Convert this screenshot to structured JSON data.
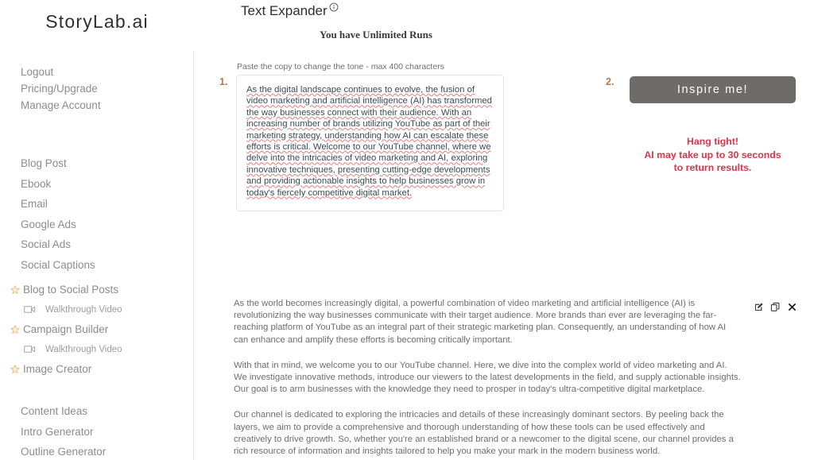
{
  "brand": {
    "name": "StoryLab.ai"
  },
  "sidebar": {
    "account_nav": [
      {
        "label": "Logout",
        "name": "logout"
      },
      {
        "label": "Pricing/Upgrade",
        "name": "pricing-upgrade"
      },
      {
        "label": "Manage Account",
        "name": "manage-account"
      }
    ],
    "tool_nav": [
      {
        "label": "Blog Post",
        "name": "blog-post"
      },
      {
        "label": "Ebook",
        "name": "ebook"
      },
      {
        "label": "Email",
        "name": "email"
      },
      {
        "label": "Google Ads",
        "name": "google-ads"
      },
      {
        "label": "Social Ads",
        "name": "social-ads"
      },
      {
        "label": "Social Captions",
        "name": "social-captions"
      }
    ],
    "featured": [
      {
        "label": "Blog to Social Posts",
        "icon": "star-icon",
        "name": "blog-to-social-posts"
      },
      {
        "label": "Walkthrough Video",
        "icon": "video-icon",
        "name": "walkthrough-video-blog-to-social"
      },
      {
        "label": "Campaign Builder",
        "icon": "star-icon",
        "name": "campaign-builder"
      },
      {
        "label": "Walkthrough Video",
        "icon": "video-icon",
        "name": "walkthrough-video-campaign-builder"
      },
      {
        "label": "Image Creator",
        "icon": "star-icon",
        "name": "image-creator"
      }
    ],
    "bottom_nav": [
      {
        "label": "Content Ideas",
        "name": "content-ideas"
      },
      {
        "label": "Intro Generator",
        "name": "intro-generator"
      },
      {
        "label": "Outline Generator",
        "name": "outline-generator"
      }
    ]
  },
  "header": {
    "title": "Text Expander",
    "info_icon": "info-circle-icon",
    "runs_status": "You have Unlimited Runs"
  },
  "input_section": {
    "step_marker": "1.",
    "hint": "Paste the copy to change the tone - max 400 characters",
    "value": "As the digital landscape continues to evolve, the fusion of video marketing and artificial intelligence (AI) has transformed the way businesses connect with their audience. With an increasing number of brands utilizing YouTube as part of their marketing strategy, understanding how AI can escalate these efforts is critical. Welcome to our YouTube channel, where we delve into the intricacies of video marketing and AI, exploring innovative techniques, presenting cutting-edge developments and providing actionable insights to help businesses grow in today's fiercely competitive digital market."
  },
  "action_section": {
    "step_marker": "2.",
    "button_label": "Inspire me!",
    "notice_line_1": "Hang tight!",
    "notice_line_2": "AI may take up to 30 seconds",
    "notice_line_3": "to return results."
  },
  "result": {
    "paragraphs": [
      "As the world becomes increasingly digital, a powerful combination of video marketing and artificial intelligence (AI) is revolutionizing the way businesses communicate with their target audience. More brands than ever are leveraging the far-reaching platform of YouTube as an integral part of their strategic marketing plan. Consequently, an understanding of how AI can enhance and amplify these efforts is becoming critically important.",
      "With that in mind, we welcome you to our YouTube channel. Here, we dive into the complex world of video marketing and AI. We investigate innovative methods, introduce our viewers to the latest developments in the field, and supply actionable insights. Our goal is to arm businesses with the knowledge they need to prosper in today's ultra-competitive digital marketplace.",
      "Our channel is dedicated to exploring the intricacies and details of these increasingly dominant sectors. By peeling back the layers, we aim to provide a comprehensive and thorough understanding of how these tools can be used effectively and creatively to drive growth. So, whether you're an established brand or a newcomer to the digital scene, our channel provides a rich resource of information and insights tailored to help you make your mark in the modern business world."
    ],
    "actions": [
      {
        "name": "edit-icon",
        "title": "Edit"
      },
      {
        "name": "copy-icon",
        "title": "Copy"
      },
      {
        "name": "close-icon",
        "title": "Close"
      }
    ]
  },
  "colors": {
    "accent_step": "#b4764a",
    "button_bg": "#6f6b6a",
    "notice": "#d9344a",
    "star": "#e8c27a",
    "text_muted": "#8c8c8c"
  }
}
